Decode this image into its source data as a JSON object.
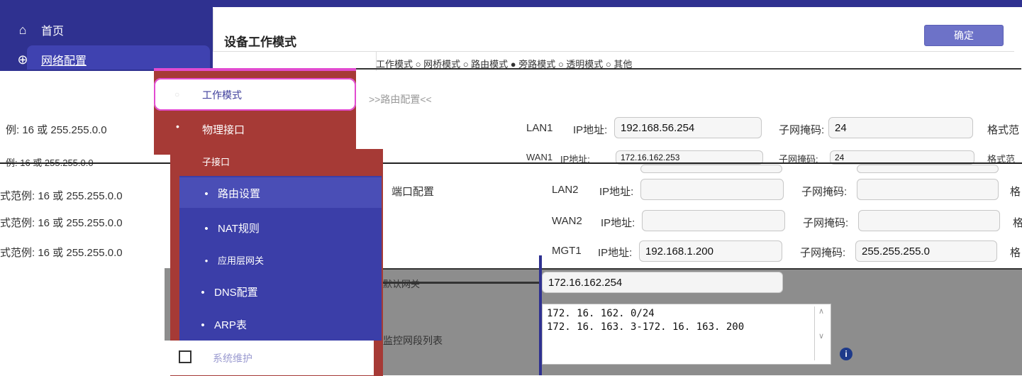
{
  "nav": {
    "home_label": "首页",
    "network_label": "网络配置"
  },
  "panel": {
    "title": "设备工作模式",
    "confirm_label": "确定",
    "mode_row": "工作模式      ○ 网桥模式   ○ 路由模式   ● 旁路模式   ○ 透明模式   ○ 其他"
  },
  "red_menu": {
    "items": [
      {
        "label": "工作模式"
      },
      {
        "label": "物理接口"
      },
      {
        "label": "子接口"
      }
    ]
  },
  "blue_menu": {
    "items": [
      {
        "label": "路由设置"
      },
      {
        "label": "NAT规则"
      },
      {
        "label": "应用层网关"
      },
      {
        "label": "DNS配置"
      },
      {
        "label": "ARP表"
      }
    ]
  },
  "bottom_card": {
    "label": "系统维护"
  },
  "section": {
    "title": ">>路由配置<<"
  },
  "hints": [
    "例: 16 或 255.255.0.0",
    "例: 16 或 255.255.0.0",
    "式范例: 16 或 255.255.0.0",
    "式范例: 16 或 255.255.0.0",
    "式范例: 16 或 255.255.0.0"
  ],
  "port_config_label": "端口配置",
  "interfaces": [
    {
      "name": "LAN1",
      "ip_label": "IP地址:",
      "ip": "192.168.56.254",
      "mask_label": "子网掩码:",
      "mask": "24",
      "fmt": "格式范"
    },
    {
      "name": "WAN1",
      "ip_label": "IP地址:",
      "ip": "172.16.162.253",
      "mask_label": "子网掩码:",
      "mask": "24",
      "fmt": "格式范"
    },
    {
      "name": "LAN2",
      "ip_label": "IP地址:",
      "ip": "",
      "mask_label": "子网掩码:",
      "mask": "",
      "fmt": "格"
    },
    {
      "name": "WAN2",
      "ip_label": "IP地址:",
      "ip": "",
      "mask_label": "子网掩码:",
      "mask": "",
      "fmt": "格"
    },
    {
      "name": "MGT1",
      "ip_label": "IP地址:",
      "ip": "192.168.1.200",
      "mask_label": "子网掩码:",
      "mask": "255.255.255.0",
      "fmt": "格"
    }
  ],
  "gateway": {
    "label": "默认网关",
    "value": "172.16.162.254"
  },
  "monitor": {
    "label": "监控网段列表",
    "lines": "172. 16. 162. 0/24\n172. 16. 163. 3-172. 16. 163. 200"
  },
  "colors": {
    "sidebar": "#2f3190",
    "red_menu": "#a63a36",
    "blue_menu": "#3b3ea8",
    "confirm": "#6d72c8",
    "active_outline": "#e24bd0"
  }
}
